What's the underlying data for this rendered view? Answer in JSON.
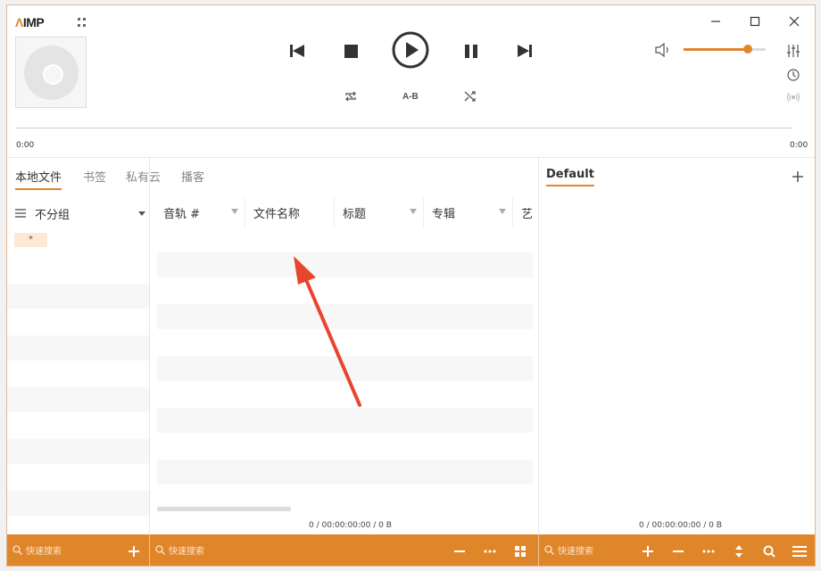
{
  "app": {
    "logo_prefix": "Λ",
    "logo_text": "IMP"
  },
  "player": {
    "time_start": "0:00",
    "time_end": "0:00",
    "ab_label": "A-B",
    "volume_fraction": 0.78
  },
  "tabs": [
    {
      "label": "本地文件",
      "active": true
    },
    {
      "label": "书签",
      "active": false
    },
    {
      "label": "私有云",
      "active": false
    },
    {
      "label": "播客",
      "active": false
    }
  ],
  "groups": {
    "header": "不分组",
    "items": [
      "*"
    ]
  },
  "columns": [
    "音轨 #",
    "文件名称",
    "标题",
    "专辑",
    "艺"
  ],
  "file_list": {
    "status": "0 / 00:00:00:00 / 0 B"
  },
  "playlist": {
    "title": "Default",
    "status": "0 / 00:00:00:00 / 0 B"
  },
  "bottom": {
    "search_left": "快速搜索",
    "search_mid": "快速搜索",
    "search_right": "快速搜索"
  },
  "colors": {
    "accent": "#e0862a",
    "annotation_arrow": "#e8452e"
  },
  "icons": [
    "minimize-icon",
    "maximize-icon",
    "close-icon",
    "previous-icon",
    "stop-icon",
    "play-icon",
    "pause-icon",
    "next-icon",
    "repeat-icon",
    "shuffle-icon",
    "volume-icon",
    "equalizer-icon",
    "clock-icon",
    "radio-icon",
    "search-icon",
    "plus-icon",
    "minus-icon",
    "more-icon",
    "grid-icon",
    "sort-icon",
    "menu-icon"
  ]
}
